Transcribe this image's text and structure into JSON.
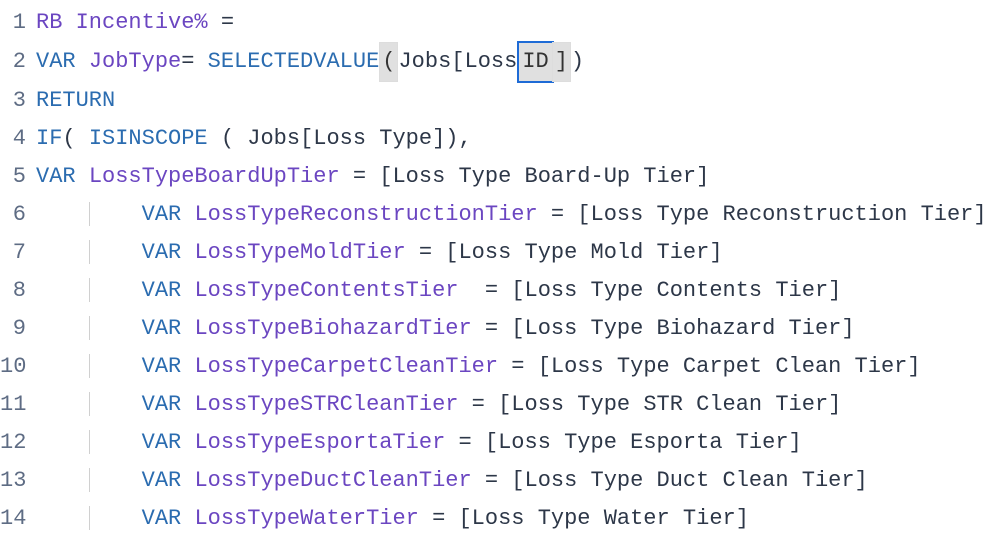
{
  "editor": {
    "language": "DAX",
    "selection": {
      "token": "ID",
      "line": 2
    },
    "colors": {
      "keyword": "#2B6CB0",
      "identifier": "#6B46C1",
      "text": "#2D3748"
    },
    "lines": [
      {
        "num": "1",
        "tokens": [
          {
            "cls": "ident",
            "t": "RB Incentive%"
          },
          {
            "cls": "text",
            "t": " ="
          }
        ]
      },
      {
        "num": "2",
        "tokens": [
          {
            "cls": "kw",
            "t": "VAR"
          },
          {
            "cls": "text",
            "t": " "
          },
          {
            "cls": "ident",
            "t": "JobType"
          },
          {
            "cls": "text",
            "t": "= "
          },
          {
            "cls": "fn",
            "t": "SELECTEDVALUE"
          },
          {
            "cls": "bbr",
            "t": "("
          },
          {
            "cls": "text",
            "t": "Jobs[Loss"
          },
          {
            "cls": "sel",
            "t": "ID"
          },
          {
            "cls": "bbr",
            "t": "]"
          },
          {
            "cls": "text",
            "t": ")"
          },
          {
            "cls": "cursor",
            "t": ""
          }
        ]
      },
      {
        "num": "3",
        "tokens": [
          {
            "cls": "kw",
            "t": "RETURN"
          }
        ]
      },
      {
        "num": "4",
        "tokens": [
          {
            "cls": "kw",
            "t": "IF"
          },
          {
            "cls": "text",
            "t": "( "
          },
          {
            "cls": "fn",
            "t": "ISINSCOPE"
          },
          {
            "cls": "text",
            "t": " ( Jobs[Loss Type]),"
          }
        ]
      },
      {
        "num": "5",
        "tokens": [
          {
            "cls": "kw",
            "t": "VAR"
          },
          {
            "cls": "text",
            "t": " "
          },
          {
            "cls": "ident",
            "t": "LossTypeBoardUpTier"
          },
          {
            "cls": "text",
            "t": " = [Loss Type Board-Up Tier]"
          }
        ]
      },
      {
        "num": "6",
        "indent": true,
        "tokens": [
          {
            "cls": "kw",
            "t": "VAR"
          },
          {
            "cls": "text",
            "t": " "
          },
          {
            "cls": "ident",
            "t": "LossTypeReconstructionTier"
          },
          {
            "cls": "text",
            "t": " = [Loss Type Reconstruction Tier]"
          }
        ]
      },
      {
        "num": "7",
        "indent": true,
        "tokens": [
          {
            "cls": "kw",
            "t": "VAR"
          },
          {
            "cls": "text",
            "t": " "
          },
          {
            "cls": "ident",
            "t": "LossTypeMoldTier"
          },
          {
            "cls": "text",
            "t": " = [Loss Type Mold Tier]"
          }
        ]
      },
      {
        "num": "8",
        "indent": true,
        "tokens": [
          {
            "cls": "kw",
            "t": "VAR"
          },
          {
            "cls": "text",
            "t": " "
          },
          {
            "cls": "ident",
            "t": "LossTypeContentsTier"
          },
          {
            "cls": "text",
            "t": "  = [Loss Type Contents Tier]"
          }
        ]
      },
      {
        "num": "9",
        "indent": true,
        "tokens": [
          {
            "cls": "kw",
            "t": "VAR"
          },
          {
            "cls": "text",
            "t": " "
          },
          {
            "cls": "ident",
            "t": "LossTypeBiohazardTier"
          },
          {
            "cls": "text",
            "t": " = [Loss Type Biohazard Tier]"
          }
        ]
      },
      {
        "num": "10",
        "indent": true,
        "tokens": [
          {
            "cls": "kw",
            "t": "VAR"
          },
          {
            "cls": "text",
            "t": " "
          },
          {
            "cls": "ident",
            "t": "LossTypeCarpetCleanTier"
          },
          {
            "cls": "text",
            "t": " = [Loss Type Carpet Clean Tier]"
          }
        ]
      },
      {
        "num": "11",
        "indent": true,
        "tokens": [
          {
            "cls": "kw",
            "t": "VAR"
          },
          {
            "cls": "text",
            "t": " "
          },
          {
            "cls": "ident",
            "t": "LossTypeSTRCleanTier"
          },
          {
            "cls": "text",
            "t": " = [Loss Type STR Clean Tier]"
          }
        ]
      },
      {
        "num": "12",
        "indent": true,
        "tokens": [
          {
            "cls": "kw",
            "t": "VAR"
          },
          {
            "cls": "text",
            "t": " "
          },
          {
            "cls": "ident",
            "t": "LossTypeEsportaTier"
          },
          {
            "cls": "text",
            "t": " = [Loss Type Esporta Tier]"
          }
        ]
      },
      {
        "num": "13",
        "indent": true,
        "tokens": [
          {
            "cls": "kw",
            "t": "VAR"
          },
          {
            "cls": "text",
            "t": " "
          },
          {
            "cls": "ident",
            "t": "LossTypeDuctCleanTier"
          },
          {
            "cls": "text",
            "t": " = [Loss Type Duct Clean Tier]"
          }
        ]
      },
      {
        "num": "14",
        "indent": true,
        "tokens": [
          {
            "cls": "kw",
            "t": "VAR"
          },
          {
            "cls": "text",
            "t": " "
          },
          {
            "cls": "ident",
            "t": "LossTypeWaterTier"
          },
          {
            "cls": "text",
            "t": " = [Loss Type Water Tier]"
          }
        ]
      }
    ]
  }
}
